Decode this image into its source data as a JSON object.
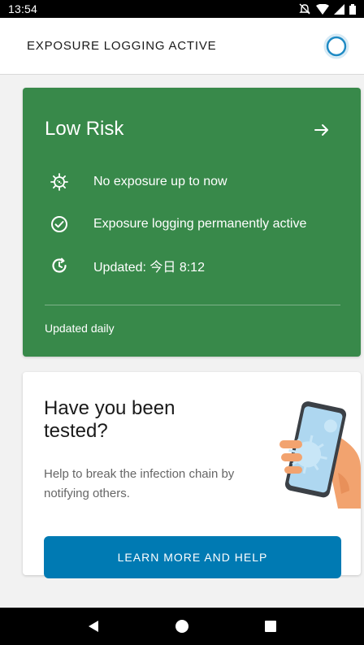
{
  "status_bar": {
    "time": "13:54"
  },
  "app_bar": {
    "title": "EXPOSURE LOGGING ACTIVE"
  },
  "risk_card": {
    "title": "Low Risk",
    "rows": [
      {
        "icon": "virus-icon",
        "text": "No exposure up to now"
      },
      {
        "icon": "check-circle-icon",
        "text": "Exposure logging permanently active"
      },
      {
        "icon": "clock-refresh-icon",
        "text": "Updated: 今日 8:12"
      }
    ],
    "footer": "Updated daily",
    "color": "#38894a"
  },
  "tested_card": {
    "title": "Have you been tested?",
    "body": "Help to break the infection chain by notifying others.",
    "button_label": "LEARN MORE AND HELP",
    "button_color": "#007ab3"
  },
  "icons": {
    "nav_back": "back-triangle-icon",
    "nav_home": "home-circle-icon",
    "nav_recents": "recents-square-icon"
  }
}
